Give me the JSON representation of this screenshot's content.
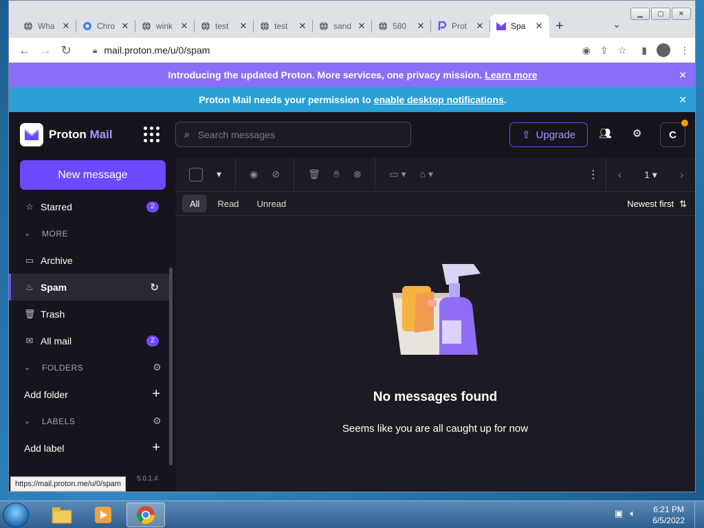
{
  "browser": {
    "tabs": [
      {
        "title": "Wha",
        "favicon": "globe-icon"
      },
      {
        "title": "Chro",
        "favicon": "chrome-icon"
      },
      {
        "title": "wink",
        "favicon": "globe-icon"
      },
      {
        "title": "test",
        "favicon": "globe-icon"
      },
      {
        "title": "test",
        "favicon": "globe-icon"
      },
      {
        "title": "sand",
        "favicon": "globe-icon"
      },
      {
        "title": "580",
        "favicon": "globe-icon"
      },
      {
        "title": "Prot",
        "favicon": "proton-p-icon"
      },
      {
        "title": "Spa",
        "favicon": "proton-mail-icon",
        "active": true
      }
    ],
    "url": "mail.proton.me/u/0/spam",
    "status_url": "https://mail.proton.me/u/0/spam"
  },
  "banners": {
    "promo": {
      "text": "Introducing the updated Proton. More services, one privacy mission.",
      "link": "Learn more"
    },
    "notify": {
      "text": "Proton Mail needs your permission to",
      "link": "enable desktop notifications",
      "suffix": "."
    }
  },
  "brand": {
    "name": "Proton",
    "product": "Mail",
    "accent": "#6d4aff"
  },
  "sidebar": {
    "new_message": "New message",
    "items": [
      {
        "label": "Starred",
        "icon": "star-icon",
        "badge": "2"
      },
      {
        "label": "MORE",
        "section": true
      },
      {
        "label": "Archive",
        "icon": "archive-icon"
      },
      {
        "label": "Spam",
        "icon": "fire-icon",
        "active": true
      },
      {
        "label": "Trash",
        "icon": "trash-icon"
      },
      {
        "label": "All mail",
        "icon": "envelopes-icon",
        "badge": "2"
      }
    ],
    "folders_label": "FOLDERS",
    "add_folder": "Add folder",
    "labels_label": "LABELS",
    "add_label": "Add label",
    "version": "5.0.1.4"
  },
  "header": {
    "search_placeholder": "Search messages",
    "upgrade": "Upgrade",
    "avatar_initial": "C"
  },
  "mailbox": {
    "filters": [
      "All",
      "Read",
      "Unread"
    ],
    "active_filter": "All",
    "sort": "Newest first",
    "page": "1",
    "empty_title": "No messages found",
    "empty_subtitle": "Seems like you are all caught up for now"
  },
  "taskbar": {
    "time": "6:21 PM",
    "date": "6/5/2022"
  }
}
